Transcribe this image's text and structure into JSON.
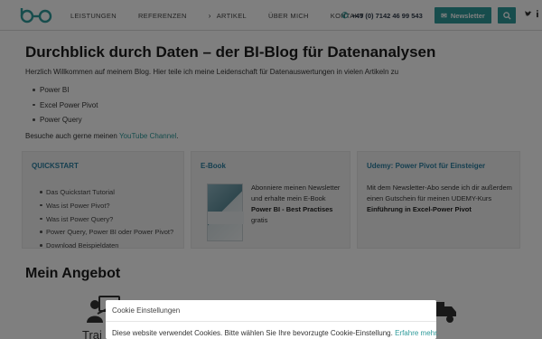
{
  "header": {
    "nav": [
      {
        "label": "LEISTUNGEN",
        "chevron": false
      },
      {
        "label": "REFERENZEN",
        "chevron": false
      },
      {
        "label": "ARTIKEL",
        "chevron": true
      },
      {
        "label": "ÜBER MICH",
        "chevron": false
      },
      {
        "label": "KONTAKT",
        "chevron": false
      }
    ],
    "phone": "+49 (0) 7142 46 99 543",
    "newsletter_label": "Newsletter",
    "icons": [
      "logo",
      "phone-icon",
      "envelope-icon",
      "search-icon",
      "twitter-icon",
      "linkedin-icon"
    ]
  },
  "main": {
    "title": "Durchblick durch Daten – der BI-Blog für Datenanalysen",
    "intro": "Herzlich Willkommen auf meinem Blog. Hier teile ich meine Leidenschaft für Datenauswertungen in vielen Artikeln zu",
    "topics": [
      "Power BI",
      "Excel Power Pivot",
      "Power Query"
    ],
    "visit_prefix": "Besuche auch gerne meinen ",
    "visit_link": "YouTube Channel",
    "visit_suffix": "."
  },
  "cards": {
    "quickstart": {
      "title": "QUICKSTART",
      "items": [
        "Das Quickstart Tutorial",
        "Was ist Power Pivot?",
        "Was ist Power Query?",
        "Power Query, Power BI oder Power Pivot?",
        "Download Beispieldaten"
      ]
    },
    "ebook": {
      "title": "E-Book",
      "text": "Abonniere meinen Newsletter und erhalte mein E-Book",
      "bold": "Power BI - Best Practises",
      "suffix": "gratis"
    },
    "udemy": {
      "title": "Udemy: Power Pivot für Einsteiger",
      "text": "Mit dem Newsletter-Abo sende ich dir außerdem einen Gutschein für meinen UDEMY-Kurs",
      "bold": "Einführung in Excel-Power Pivot"
    }
  },
  "angebot": {
    "title": "Mein Angebot",
    "trainer_label": "Trai"
  },
  "cookie": {
    "header": "Cookie Einstellungen",
    "text": "Diese website verwendet Cookies. Bitte wählen Sie Ihre bevorzugte Cookie-Einstellung.",
    "link": "Erfahre mehr."
  }
}
